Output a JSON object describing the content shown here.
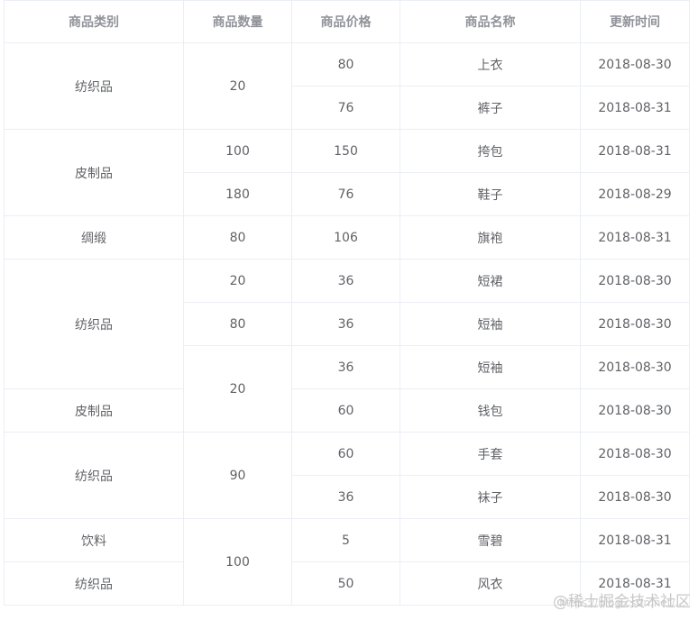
{
  "headers": [
    "商品类别",
    "商品数量",
    "商品价格",
    "商品名称",
    "更新时间"
  ],
  "rows": [
    {
      "category": "纺织品",
      "quantity": "20",
      "price": "80",
      "name": "上衣",
      "date": "2018-08-30"
    },
    {
      "price": "76",
      "name": "裤子",
      "date": "2018-08-31"
    },
    {
      "category": "皮制品",
      "quantity": "100",
      "price": "150",
      "name": "挎包",
      "date": "2018-08-31"
    },
    {
      "quantity": "180",
      "price": "76",
      "name": "鞋子",
      "date": "2018-08-29"
    },
    {
      "category": "绸缎",
      "quantity": "80",
      "price": "106",
      "name": "旗袍",
      "date": "2018-08-31"
    },
    {
      "category": "纺织品",
      "quantity": "20",
      "price": "36",
      "name": "短裙",
      "date": "2018-08-30"
    },
    {
      "quantity": "80",
      "price": "36",
      "name": "短袖",
      "date": "2018-08-30"
    },
    {
      "quantity": "20",
      "price": "36",
      "name": "短袖",
      "date": "2018-08-30"
    },
    {
      "category": "皮制品",
      "price": "60",
      "name": "钱包",
      "date": "2018-08-30"
    },
    {
      "category": "纺织品",
      "quantity": "90",
      "price": "60",
      "name": "手套",
      "date": "2018-08-30"
    },
    {
      "price": "36",
      "name": "袜子",
      "date": "2018-08-30"
    },
    {
      "category": "饮料",
      "quantity": "100",
      "price": "5",
      "name": "雪碧",
      "date": "2018-08-31"
    },
    {
      "category": "纺织品",
      "price": "50",
      "name": "风衣",
      "date": "2018-08-31"
    }
  ],
  "watermark": {
    "site": "@稀土掘金技术社区",
    "url": "https://blog.csdn.net/..."
  }
}
